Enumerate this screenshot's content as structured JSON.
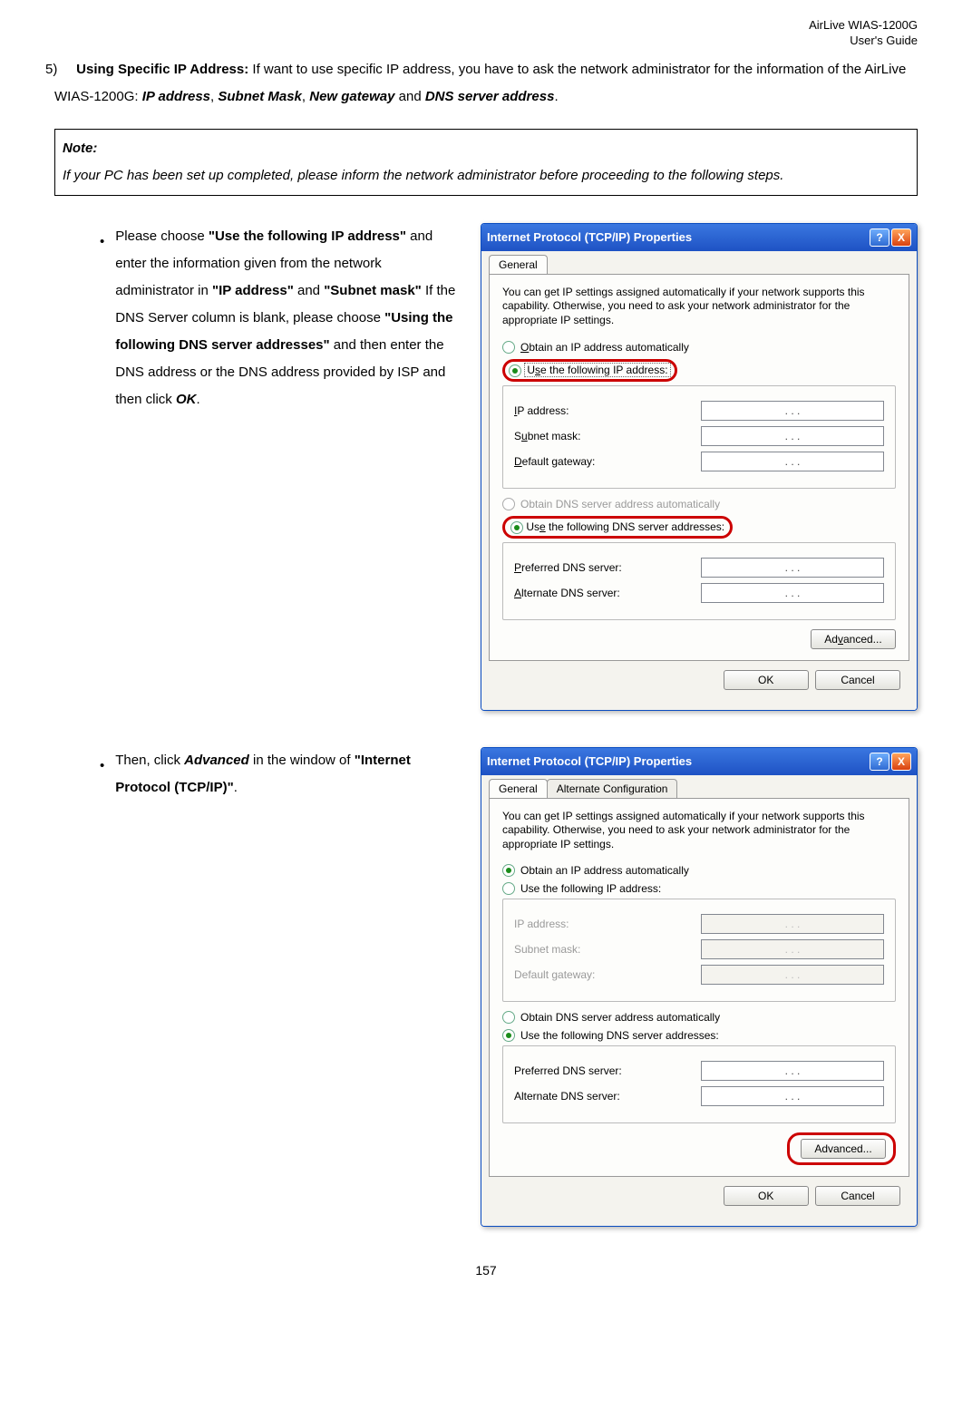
{
  "header": {
    "line1": "AirLive WIAS-1200G",
    "line2": "User's Guide"
  },
  "step": {
    "num": "5)",
    "bold1": "Using Specific IP Address:",
    "t1": " If want to use specific IP address, you have to ask the network administrator for the information of the AirLive WIAS-1200G: ",
    "bold2": "IP address",
    "sep1": ", ",
    "bold3": "Subnet Mask",
    "sep2": ", ",
    "bold4": "New gateway",
    "sep3": " and ",
    "bold5": "DNS server address",
    "end": "."
  },
  "note": {
    "title": "Note:",
    "body": "If your PC has been set up completed, please inform the network administrator before proceeding to the following steps."
  },
  "bullet1": {
    "p1": "Please choose ",
    "b1": "\"Use the following IP address\"",
    "p2": " and enter the information given from the network administrator in ",
    "b2": "\"IP address\"",
    "p3": " and ",
    "b3": "\"Subnet mask\"",
    "p4": " If the DNS Server column is blank, please choose ",
    "b4": "\"Using the following DNS server addresses\"",
    "p5": " and then enter the DNS address or the DNS address provided by ISP and then click ",
    "b5": "OK",
    "p6": "."
  },
  "bullet2": {
    "p1": "Then, click ",
    "b1": "Advanced",
    "p2": " in the window of ",
    "b2": "\"Internet Protocol (TCP/IP)\"",
    "p3": "."
  },
  "dialog": {
    "title": "Internet Protocol (TCP/IP) Properties",
    "tabs": {
      "general": "General",
      "alt": "Alternate Configuration"
    },
    "desc": "You can get IP settings assigned automatically if your network supports this capability. Otherwise, you need to ask your network administrator for the appropriate IP settings.",
    "opt_auto_ip": "Obtain an IP address automatically",
    "opt_use_ip": "Use the following IP address:",
    "ip": "IP address:",
    "subnet": "Subnet mask:",
    "gateway": "Default gateway:",
    "opt_auto_dns": "Obtain DNS server address automatically",
    "opt_use_dns": "Use the following DNS server addresses:",
    "pref_dns": "Preferred DNS server:",
    "alt_dns": "Alternate DNS server:",
    "advanced": "Advanced...",
    "ok": "OK",
    "cancel": "Cancel",
    "dots": ".       .       ."
  },
  "pagenum": "157"
}
